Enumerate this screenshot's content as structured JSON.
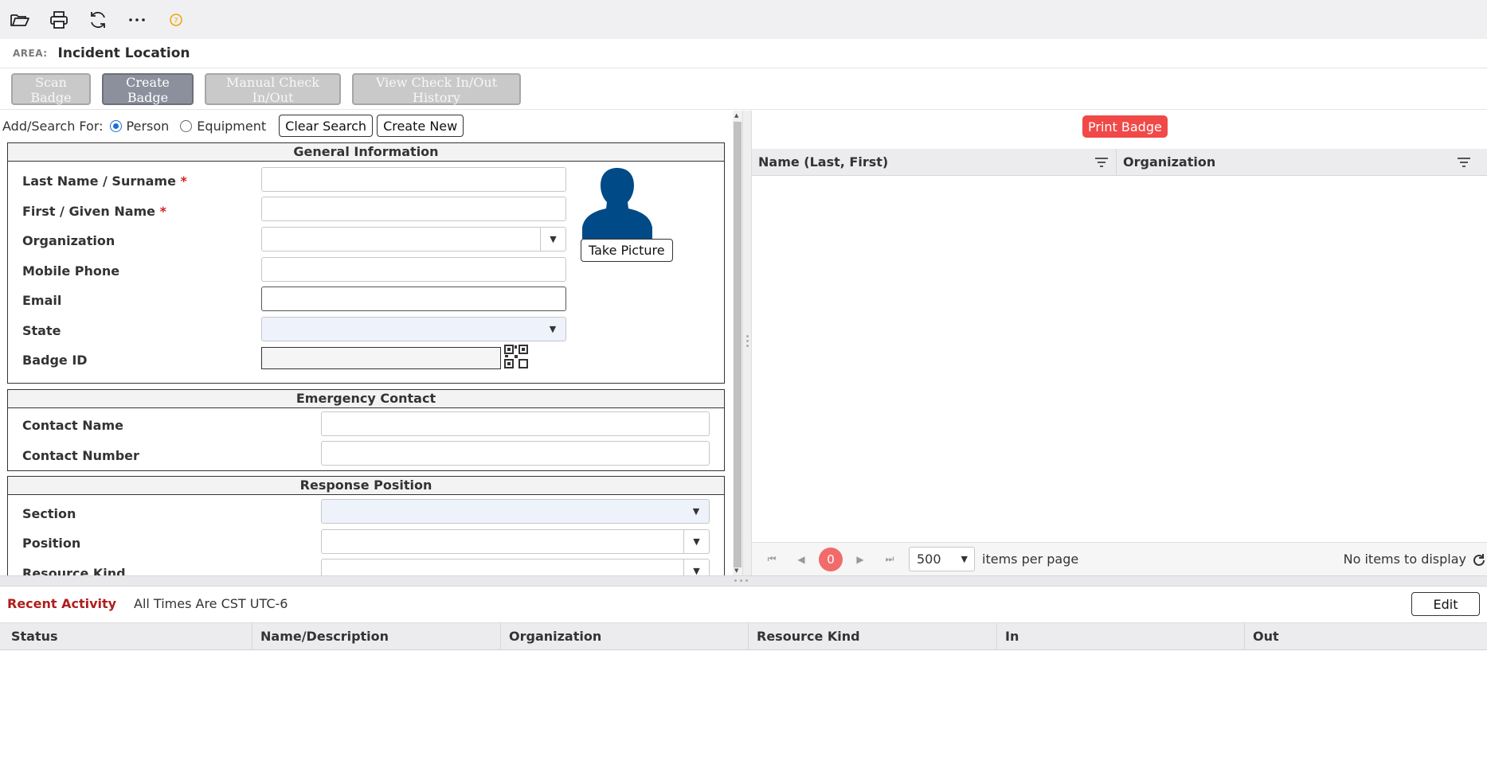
{
  "toolbar": {
    "icons": [
      "folder-open-icon",
      "print-icon",
      "refresh-icon",
      "more-icon",
      "help-icon"
    ]
  },
  "area": {
    "label": "AREA:",
    "value": "Incident Location"
  },
  "actions": {
    "scan_badge": "Scan Badge",
    "create_badge": "Create Badge",
    "manual_check": "Manual Check In/Out",
    "view_history": "View Check In/Out History"
  },
  "search": {
    "label": "Add/Search For:",
    "person": "Person",
    "equipment": "Equipment",
    "selected": "Person",
    "clear": "Clear Search",
    "create_new": "Create New"
  },
  "general": {
    "title": "General Information",
    "last_name": "Last Name / Surname",
    "first_name": "First / Given Name",
    "required_mark": "*",
    "organization": "Organization",
    "mobile": "Mobile Phone",
    "email": "Email",
    "state": "State",
    "badge_id": "Badge ID",
    "take_picture": "Take Picture"
  },
  "emergency": {
    "title": "Emergency Contact",
    "contact_name": "Contact Name",
    "contact_number": "Contact Number"
  },
  "response": {
    "title": "Response Position",
    "section": "Section",
    "position": "Position",
    "resource_kind": "Resource Kind"
  },
  "badge_grid": {
    "print_badge": "Print Badge",
    "columns": [
      "Name (Last, First)",
      "Organization"
    ],
    "current_page": "0",
    "page_size": "500",
    "items_per_page": "items per page",
    "no_items": "No items to display"
  },
  "recent": {
    "title": "Recent Activity",
    "note": "All Times Are CST UTC-6",
    "edit": "Edit",
    "columns": [
      "Status",
      "Name/Description",
      "Organization",
      "Resource Kind",
      "In",
      "Out"
    ]
  },
  "colors": {
    "print_badge": "#f14848",
    "recent_title": "#b01d1d",
    "avatar": "#004a87",
    "radio": "#1a6fd1"
  }
}
